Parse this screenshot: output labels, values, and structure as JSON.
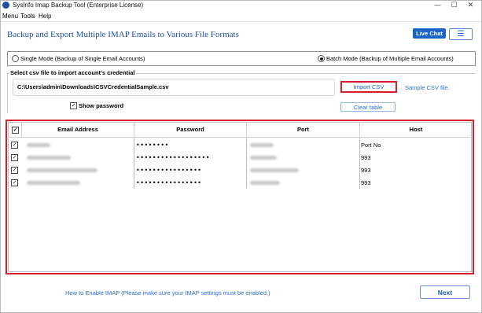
{
  "window": {
    "title": "SysInfo Imap Backup Tool (Enterprise License)",
    "controls": {
      "minimize": "—",
      "maximize": "☐",
      "close": "✕"
    }
  },
  "menu": [
    "Menu",
    "Tools",
    "Help"
  ],
  "header": {
    "headline": "Backup and Export Multiple IMAP Emails to Various File Formats",
    "live_chat": "Live Chat",
    "menu_icon": "☰"
  },
  "modes": {
    "single": "Single Mode (Backup of Single Email Accounts)",
    "batch": "Batch Mode (Backup of Multiple Email Accounts)",
    "selected": "batch"
  },
  "csv": {
    "caption": "Select csv file to import account's credential",
    "path": "C:\\Users\\admin\\Downloads\\CSVCredentialSample.csv",
    "import_button": "Import CSV",
    "sample_link": "Sample CSV file.",
    "show_password": "Show password",
    "show_password_checked": true,
    "clear_button": "Clear table"
  },
  "table": {
    "columns": [
      "Email Address",
      "Password",
      "Port",
      "Host"
    ],
    "rows": [
      {
        "checked": true,
        "password": "••••••••",
        "host": "Port No"
      },
      {
        "checked": true,
        "password": "••••••••••••••••••",
        "host": "993"
      },
      {
        "checked": true,
        "password": "••••••••••••••••",
        "host": "993"
      },
      {
        "checked": true,
        "password": "••••••••••••••••",
        "host": "993"
      }
    ]
  },
  "footer": {
    "help_link": "How to Enable IMAP (Please make sure your IMAP settings must be enabled.)",
    "next_button": "Next"
  },
  "colors": {
    "accent": "#1a63c8",
    "highlight": "#d81d2c"
  }
}
